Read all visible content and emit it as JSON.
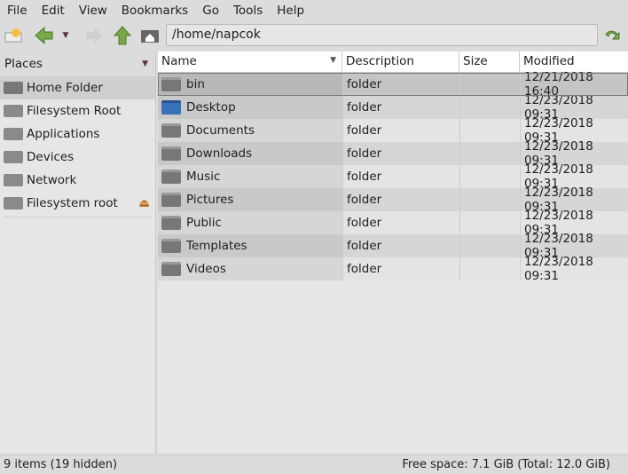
{
  "menu": [
    "File",
    "Edit",
    "View",
    "Bookmarks",
    "Go",
    "Tools",
    "Help"
  ],
  "address": "/home/napcok",
  "places": {
    "title": "Places",
    "items": [
      {
        "label": "Home Folder",
        "icon": "home-folder-icon",
        "selected": true
      },
      {
        "label": "Filesystem Root",
        "icon": "drive-icon"
      },
      {
        "label": "Applications",
        "icon": "applications-icon"
      },
      {
        "label": "Devices",
        "icon": "computer-icon"
      },
      {
        "label": "Network",
        "icon": "network-icon"
      },
      {
        "label": "Filesystem root",
        "icon": "drive-icon",
        "eject": "⏏"
      }
    ]
  },
  "columns": [
    "Name",
    "Description",
    "Size",
    "Modified"
  ],
  "files": [
    {
      "name": "bin",
      "desc": "folder",
      "size": "",
      "modified": "12/21/2018 16:40",
      "icon": "folder-icon"
    },
    {
      "name": "Desktop",
      "desc": "folder",
      "size": "",
      "modified": "12/23/2018 09:31",
      "icon": "desktop-icon"
    },
    {
      "name": "Documents",
      "desc": "folder",
      "size": "",
      "modified": "12/23/2018 09:31",
      "icon": "folder-documents-icon"
    },
    {
      "name": "Downloads",
      "desc": "folder",
      "size": "",
      "modified": "12/23/2018 09:31",
      "icon": "folder-downloads-icon"
    },
    {
      "name": "Music",
      "desc": "folder",
      "size": "",
      "modified": "12/23/2018 09:31",
      "icon": "folder-music-icon"
    },
    {
      "name": "Pictures",
      "desc": "folder",
      "size": "",
      "modified": "12/23/2018 09:31",
      "icon": "folder-pictures-icon"
    },
    {
      "name": "Public",
      "desc": "folder",
      "size": "",
      "modified": "12/23/2018 09:31",
      "icon": "folder-public-icon"
    },
    {
      "name": "Templates",
      "desc": "folder",
      "size": "",
      "modified": "12/23/2018 09:31",
      "icon": "folder-templates-icon"
    },
    {
      "name": "Videos",
      "desc": "folder",
      "size": "",
      "modified": "12/23/2018 09:31",
      "icon": "folder-videos-icon"
    }
  ],
  "status": {
    "left": "9 items (19 hidden)",
    "right": "Free space: 7.1 GiB (Total: 12.0 GiB)"
  }
}
